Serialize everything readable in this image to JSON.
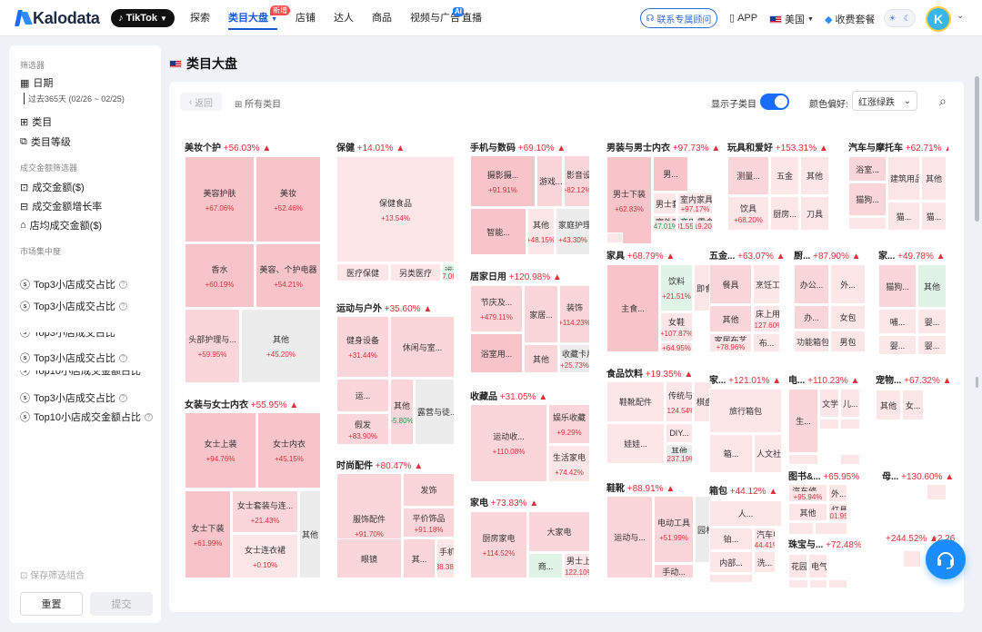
{
  "topbar": {
    "logo": "Kalodata",
    "platform": "TikTok",
    "nav": [
      {
        "label": "探索",
        "active": false
      },
      {
        "label": "类目大盘",
        "active": true,
        "badge": "新增"
      },
      {
        "label": "店铺",
        "active": false
      },
      {
        "label": "达人",
        "active": false
      },
      {
        "label": "商品",
        "active": false
      },
      {
        "label": "视频与广告",
        "active": false,
        "badge": "AI"
      },
      {
        "label": "直播",
        "active": false
      }
    ],
    "consult": "联系专属顾问",
    "app": "APP",
    "region": "美国",
    "plan": "收费套餐",
    "avatar": "K"
  },
  "sidebar": {
    "filter_title": "筛选器",
    "date_label": "日期",
    "date_range": "过去365天 (02/26 ~ 02/25)",
    "category": "类目",
    "category_level": "类目等级",
    "gmv_group": "成交金额筛选器",
    "gmv": "成交金额($)",
    "gmv_growth": "成交金额增长率",
    "avg_store_gmv": "店均成交金额($)",
    "concentration_group": "市场集中度",
    "concentration_items": [
      "Top3小店成交占比",
      "Top3小店成交占比",
      "Top3小店成交占比",
      "Top3小店成交占比",
      "Top10小店成交金额占比",
      "Top3小店成交占比",
      "Top10小店成交金额占比"
    ],
    "save_combo": "保存筛选组合",
    "reset": "重置",
    "submit": "提交"
  },
  "page": {
    "title": "类目大盘",
    "back": "返回",
    "all_categories": "所有类目",
    "show_subcategories": "显示子类目",
    "color_pref_label": "颜色偏好:",
    "color_pref_value": "红涨绿跌"
  },
  "colors": {
    "accent": "#1a6cff",
    "up": "#e0303a",
    "down": "#1f9d55",
    "tile_up": "#f6c4c9",
    "tile_neutral": "#ececec"
  },
  "treemap": {
    "categories": [
      {
        "name": "美妆个护",
        "pct": "+56.03% ▲"
      },
      {
        "name": "女装与女士内衣",
        "pct": "+55.95% ▲"
      },
      {
        "name": "保健",
        "pct": "+14.01% ▲"
      },
      {
        "name": "运动与户外",
        "pct": "+35.60% ▲"
      },
      {
        "name": "时尚配件",
        "pct": "+80.47% ▲"
      },
      {
        "name": "手机与数码",
        "pct": "+69.10% ▲"
      },
      {
        "name": "居家日用",
        "pct": "+120.98% ▲"
      },
      {
        "name": "收藏品",
        "pct": "+31.05% ▲"
      },
      {
        "name": "家电",
        "pct": "+73.83% ▲"
      },
      {
        "name": "男装与男士内衣",
        "pct": "+97.73% ▲"
      },
      {
        "name": "家具",
        "pct": "+68.79% ▲"
      },
      {
        "name": "食品饮料",
        "pct": "+19.35% ▲"
      },
      {
        "name": "鞋靴",
        "pct": "+88.91% ▲"
      },
      {
        "name": "玩具和爱好",
        "pct": "+153.31% ▲"
      },
      {
        "name": "五金...",
        "pct": "+63.07% ▲"
      },
      {
        "name": "家...",
        "pct": "+121.01% ▲"
      },
      {
        "name": "箱包",
        "pct": "+44.12% ▲"
      },
      {
        "name": "厨...",
        "pct": "+87.90% ▲"
      },
      {
        "name": "电...",
        "pct": "+110.23% ▲"
      },
      {
        "name": "图书&...",
        "pct": "+65.95% ▲"
      },
      {
        "name": "珠宝与...",
        "pct": "+72.48% ▲"
      },
      {
        "name": "汽车与摩托车",
        "pct": "+62.71% ▲"
      },
      {
        "name": "家...",
        "pct": "+49.78% ▲"
      },
      {
        "name": "宠物...",
        "pct": "+67.32% ▲"
      },
      {
        "name": "母...",
        "pct": "+130.60% ▲"
      },
      {
        "name": "",
        "pct": "+244.52% ▲"
      },
      {
        "name": "",
        "pct": "+2.26"
      }
    ],
    "tiles": [
      {
        "n": "美容护肤",
        "v": "+67.06%"
      },
      {
        "n": "美妆",
        "v": "+52.46%"
      },
      {
        "n": "香水",
        "v": "+60.19%"
      },
      {
        "n": "美容、个护电器",
        "v": "+54.21%"
      },
      {
        "n": "头部护理与...",
        "v": "+59.95%"
      },
      {
        "n": "其他",
        "v": "+45.20%"
      },
      {
        "n": "女士上装",
        "v": "+94.76%"
      },
      {
        "n": "女士内衣",
        "v": "+45.15%"
      },
      {
        "n": "女士下装",
        "v": "+61.99%"
      },
      {
        "n": "女士套装与连...",
        "v": "+21.43%"
      },
      {
        "n": "女士连衣裙",
        "v": "+0.10%"
      },
      {
        "n": "其他",
        "v": ""
      },
      {
        "n": "保健食品",
        "v": "+13.54%"
      },
      {
        "n": "医疗保健",
        "v": ""
      },
      {
        "n": "另类医疗",
        "v": ""
      },
      {
        "n": "运动服饰",
        "v": "+37.09%"
      },
      {
        "n": "健身设备",
        "v": "+31.44%"
      },
      {
        "n": "休闲与室...",
        "v": ""
      },
      {
        "n": "运...",
        "v": ""
      },
      {
        "n": "其他",
        "v": "-5.80%"
      },
      {
        "n": "露营与徒...",
        "v": ""
      },
      {
        "n": "假发",
        "v": "+83.90%"
      },
      {
        "n": "服饰配件",
        "v": "+91.70%"
      },
      {
        "n": "发饰",
        "v": ""
      },
      {
        "n": "平价饰品",
        "v": "+91.18%"
      },
      {
        "n": "眼镜",
        "v": ""
      },
      {
        "n": "其...",
        "v": ""
      },
      {
        "n": "手机与配件",
        "v": "+38.38%"
      },
      {
        "n": "摄影摄...",
        "v": "+91.91%"
      },
      {
        "n": "游戏...",
        "v": ""
      },
      {
        "n": "影音设备",
        "v": "+82.12%"
      },
      {
        "n": "智能...",
        "v": ""
      },
      {
        "n": "其他",
        "v": "+48.15%"
      },
      {
        "n": "家庭护理...",
        "v": "+43.30%"
      },
      {
        "n": "节庆及...",
        "v": "+479.11%"
      },
      {
        "n": "家居...",
        "v": ""
      },
      {
        "n": "装饰",
        "v": "+114.23%"
      },
      {
        "n": "浴室用...",
        "v": ""
      },
      {
        "n": "其他",
        "v": ""
      },
      {
        "n": "收藏卡片及配件",
        "v": "+25.73%"
      },
      {
        "n": "运动收...",
        "v": "+110.08%"
      },
      {
        "n": "娱乐收藏",
        "v": "+9.29%"
      },
      {
        "n": "生活家电",
        "v": "+74.42%"
      },
      {
        "n": "厨房家电",
        "v": "+114.52%"
      },
      {
        "n": "大家电",
        "v": ""
      },
      {
        "n": "商...",
        "v": ""
      },
      {
        "n": "男士上装",
        "v": "+122.10%"
      },
      {
        "n": "男士下装",
        "v": "+62.83%"
      },
      {
        "n": "男...",
        "v": ""
      },
      {
        "n": "男士套...",
        "v": ""
      },
      {
        "n": "室内家具",
        "v": "+97.17%"
      },
      {
        "n": "室外家...",
        "v": "-47.01%"
      },
      {
        "n": "商用家...",
        "v": "+81.55%"
      },
      {
        "n": "零食",
        "v": "+19.20%"
      },
      {
        "n": "主食...",
        "v": ""
      },
      {
        "n": "饮料",
        "v": "+21.51%"
      },
      {
        "n": "即食...",
        "v": ""
      },
      {
        "n": "女鞋",
        "v": "+107.87%"
      },
      {
        "n": "男鞋",
        "v": "+64.95%"
      },
      {
        "n": "鞋靴配件",
        "v": ""
      },
      {
        "n": "传统与...",
        "v": "+124.54%"
      },
      {
        "n": "棋盘...",
        "v": ""
      },
      {
        "n": "娃娃...",
        "v": ""
      },
      {
        "n": "DIY...",
        "v": ""
      },
      {
        "n": "其他",
        "v": "+237.19%"
      },
      {
        "n": "运动与...",
        "v": ""
      },
      {
        "n": "电动工具",
        "v": "+51.99%"
      },
      {
        "n": "手动...",
        "v": ""
      },
      {
        "n": "园林工具",
        "v": ""
      },
      {
        "n": "测量...",
        "v": ""
      },
      {
        "n": "五金",
        "v": ""
      },
      {
        "n": "其他",
        "v": ""
      },
      {
        "n": "饮具",
        "v": "+68.20%"
      },
      {
        "n": "厨房...",
        "v": ""
      },
      {
        "n": "刀具",
        "v": ""
      },
      {
        "n": "餐具",
        "v": ""
      },
      {
        "n": "烹饪工...",
        "v": ""
      },
      {
        "n": "其他",
        "v": ""
      },
      {
        "n": "床上用品",
        "v": "+127.60%"
      },
      {
        "n": "家居布艺",
        "v": "+78.96%"
      },
      {
        "n": "布...",
        "v": ""
      },
      {
        "n": "办公...",
        "v": ""
      },
      {
        "n": "外...",
        "v": ""
      },
      {
        "n": "办...",
        "v": ""
      },
      {
        "n": "女包",
        "v": ""
      },
      {
        "n": "功能箱包",
        "v": ""
      },
      {
        "n": "男包",
        "v": ""
      },
      {
        "n": "旅行箱包",
        "v": ""
      },
      {
        "n": "箱...",
        "v": ""
      },
      {
        "n": "人文社科",
        "v": ""
      },
      {
        "n": "生...",
        "v": ""
      },
      {
        "n": "文学与...",
        "v": ""
      },
      {
        "n": "儿...",
        "v": ""
      },
      {
        "n": "人...",
        "v": ""
      },
      {
        "n": "铂...",
        "v": ""
      },
      {
        "n": "汽车电...",
        "v": "+44.41%"
      },
      {
        "n": "内部...",
        "v": ""
      },
      {
        "n": "洗...",
        "v": ""
      },
      {
        "n": "汽车修...",
        "v": "+95.94%"
      },
      {
        "n": "外...",
        "v": ""
      },
      {
        "n": "其他",
        "v": ""
      },
      {
        "n": "灯具和...",
        "v": "+101.95%"
      },
      {
        "n": "花园...",
        "v": ""
      },
      {
        "n": "电气设...",
        "v": ""
      },
      {
        "n": "浴室...",
        "v": ""
      },
      {
        "n": "建筑用品",
        "v": ""
      },
      {
        "n": "其他",
        "v": ""
      },
      {
        "n": "猫狗...",
        "v": ""
      },
      {
        "n": "猫...",
        "v": ""
      },
      {
        "n": "猫...",
        "v": ""
      },
      {
        "n": "猫狗...",
        "v": ""
      },
      {
        "n": "其他",
        "v": ""
      },
      {
        "n": "哺...",
        "v": ""
      },
      {
        "n": "婴...",
        "v": ""
      },
      {
        "n": "婴...",
        "v": ""
      },
      {
        "n": "婴...",
        "v": ""
      },
      {
        "n": "其他",
        "v": ""
      },
      {
        "n": "女...",
        "v": ""
      }
    ]
  }
}
